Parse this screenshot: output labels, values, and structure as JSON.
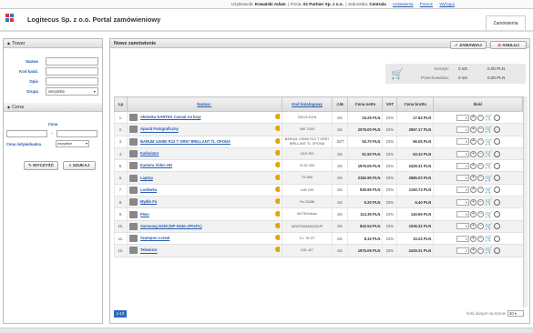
{
  "topbar": {
    "user_label": "Użytkownik:",
    "user": "Kowalski Adam",
    "firm_label": "Firma:",
    "firm": "01 Partner Sp. z o.o.",
    "unit_label": "Jednostka:",
    "unit": "Centrala",
    "settings": "Ustawienia",
    "help": "Pomoc",
    "logout": "Wyloguj"
  },
  "header": {
    "title": "Logitecus Sp. z o.o.  Portal zamówieniowy",
    "tab": "Zamówienia"
  },
  "sidebar": {
    "towar_head": "Towar",
    "fields": [
      {
        "label": "Nazwa"
      },
      {
        "label": "Kod katal."
      },
      {
        "label": "Opis"
      },
      {
        "label": "Grupa",
        "value": "wszystkie"
      }
    ],
    "cena_head": "Cena",
    "cena_label": "Cena",
    "cena_indyw_label": "Cena indywidualna",
    "cena_indyw_value": "wszystkie",
    "clear": "WYCZYŚĆ",
    "search": "SZUKAJ"
  },
  "main": {
    "head": "Nowe zamówienie",
    "order_btn": "ZAMAWIAJ",
    "cancel_btn": "ANULUJ",
    "cart": {
      "label1": "Koszyk:",
      "qty1": "0 szt.",
      "val1": "0.00 PLN",
      "label2": "Przechowalnia:",
      "qty2": "0 szt.",
      "val2": "0.00 PLN"
    },
    "columns": [
      "Lp",
      "Nazwa",
      "Kod katalogowy",
      "J.M.",
      "Cena netto",
      "VAT",
      "Cena brutto",
      "Ilość"
    ],
    "rows": [
      {
        "lp": "1.",
        "name": "Aktówka DANTEX Casual A4 brąz",
        "kod": "03013.201N",
        "jm": "szt.",
        "netto": "16.25 PLN",
        "vat": "23%",
        "brutto": "17.63 PLN"
      },
      {
        "lp": "2.",
        "name": "Aparat Fotograficzny",
        "kod": "NIK 7000",
        "jm": "szt.",
        "netto": "2079.00 PLN",
        "vat": "23%",
        "brutto": "2557.17 PLN"
      },
      {
        "lp": "3.",
        "name": "BARUM 135/80 R12 T OR57 BRILLANT TL OPONA",
        "kod": "BARUM 135/80 R12 T OR57 BRILLANT TL OPONA",
        "jm": "SZT",
        "netto": "53.70 PLN",
        "vat": "23%",
        "brutto": "66.05 PLN"
      },
      {
        "lp": "4.",
        "name": "Kalkulator",
        "kod": "CAS 350",
        "jm": "szt.",
        "netto": "51.50 PLN",
        "vat": "23%",
        "brutto": "63.34 PLN"
      },
      {
        "lp": "5.",
        "name": "Kamera Video HD",
        "kod": "S HD 400",
        "jm": "szt.",
        "netto": "1975.05 PLN",
        "vat": "23%",
        "brutto": "2429.31 PLN"
      },
      {
        "lp": "6.",
        "name": "Laptop",
        "kod": "TS 850",
        "jm": "szt.",
        "netto": "2182.95 PLN",
        "vat": "23%",
        "brutto": "2685.03 PLN"
      },
      {
        "lp": "7.",
        "name": "Lodówka",
        "kod": "LVB 200",
        "jm": "szt.",
        "netto": "935.95 PLN",
        "vat": "23%",
        "brutto": "1150.73 PLN"
      },
      {
        "lp": "8.",
        "name": "Mydło Fa",
        "kod": "Fa 23456",
        "jm": "szt.",
        "netto": "5.20 PLN",
        "vat": "23%",
        "brutto": "6.40 PLN"
      },
      {
        "lp": "9.",
        "name": "Piwo",
        "kod": "AKT40/obraz",
        "jm": "szt.",
        "netto": "114.35 PLN",
        "vat": "23%",
        "brutto": "140.65 PLN"
      },
      {
        "lp": "10.",
        "name": "Samsung N150 (NP-N150-JP01PL)",
        "kod": "NENTBSAMN150JP",
        "jm": "szt.",
        "netto": "842.54 PLN",
        "vat": "23%",
        "brutto": "1036.32 PLN"
      },
      {
        "lp": "11.",
        "name": "Szampon Loreal",
        "kod": "S L 78 GT",
        "jm": "szt.",
        "netto": "8.32 PLN",
        "vat": "23%",
        "brutto": "10.23 PLN"
      },
      {
        "lp": "12.",
        "name": "Telewizor",
        "kod": "KDL 40\"",
        "jm": "szt.",
        "netto": "1975.05 PLN",
        "vat": "23%",
        "brutto": "2429.31 PLN"
      }
    ],
    "qty_value": "0",
    "pager": "1-13",
    "perpage_label": "Ilość danych na stronie",
    "perpage_value": "20"
  }
}
